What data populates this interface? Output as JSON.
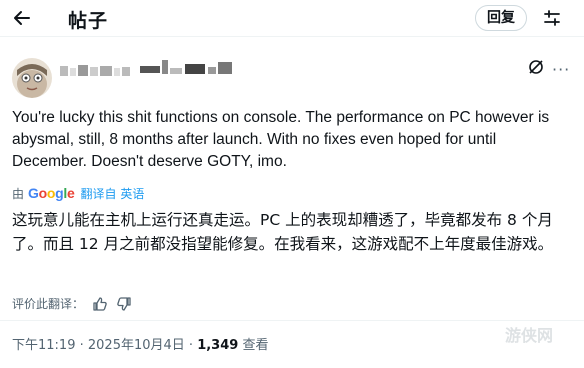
{
  "header": {
    "title": "帖子",
    "reply_label": "回复"
  },
  "post": {
    "text_en": "You're lucky this shit functions on console. The performance on PC however is abysmal, still, 8 months after launch. With no fixes even hoped for until December. Doesn't deserve GOTY, imo.",
    "translated_by": "由",
    "google_letters": [
      "G",
      "o",
      "o",
      "g",
      "l",
      "e"
    ],
    "google_colors": [
      "#4285F4",
      "#EA4335",
      "#FBBC05",
      "#4285F4",
      "#34A853",
      "#EA4335"
    ],
    "translated_from": "翻译自 英语",
    "text_zh": "这玩意儿能在主机上运行还真走运。PC 上的表现却糟透了，毕竟都发布 8 个月了。而且 12 月之前都没指望能修复。在我看来，这游戏配不上年度最佳游戏。",
    "rate_translation": "评价此翻译：",
    "time": "下午11:19",
    "date": "2025年10月4日",
    "views": "1,349",
    "views_label": "查看"
  },
  "watermark": "游侠网",
  "icons": [
    "back-arrow-icon",
    "adjust-icon",
    "grok-icon",
    "more-icon",
    "thumbs-up-icon",
    "thumbs-down-icon"
  ]
}
